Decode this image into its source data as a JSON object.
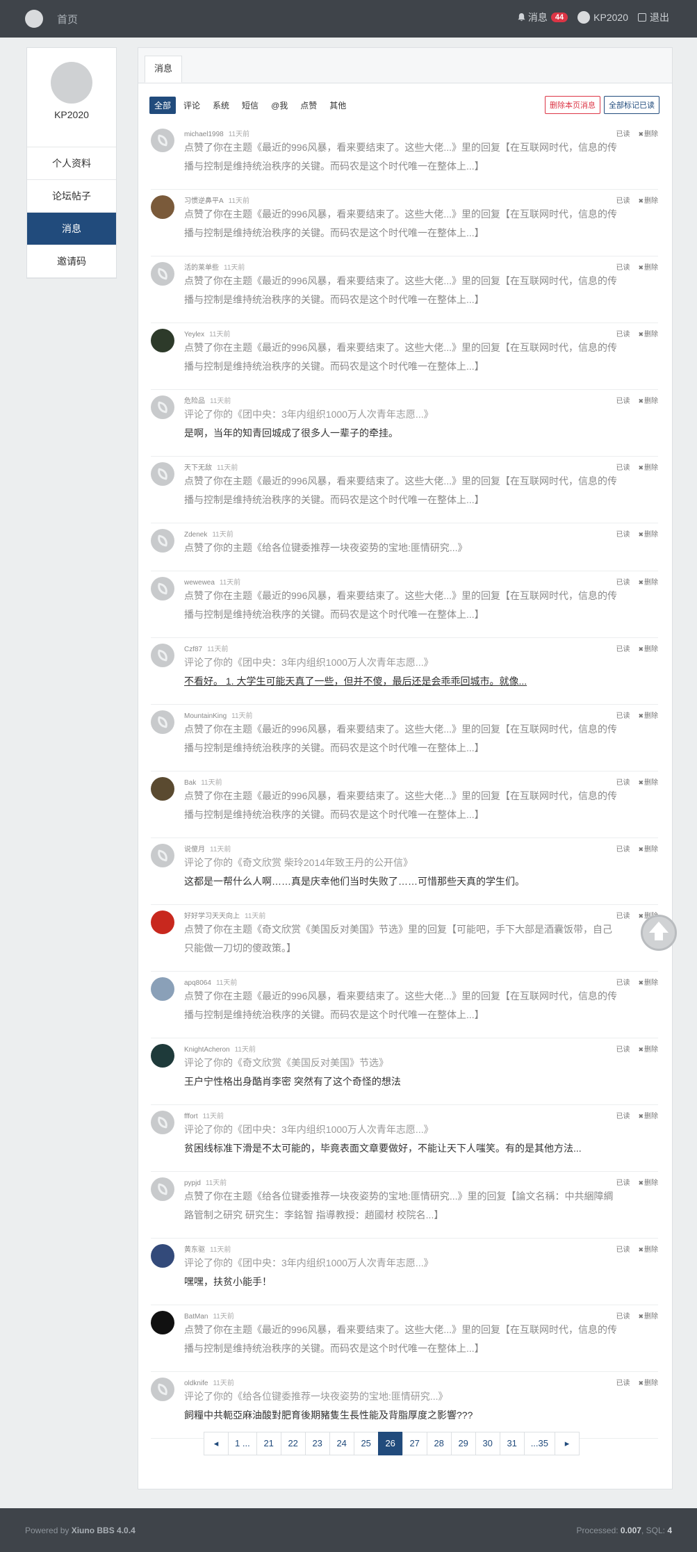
{
  "nav": {
    "home": "首页",
    "messages_label": "消息",
    "messages_count": "44",
    "user": "KP2020",
    "logout": "退出"
  },
  "sidebar": {
    "username": "KP2020",
    "items": [
      {
        "label": "个人资料"
      },
      {
        "label": "论坛帖子"
      },
      {
        "label": "消息",
        "active": true
      },
      {
        "label": "邀请码"
      }
    ]
  },
  "main": {
    "tab": "消息",
    "filters": [
      "全部",
      "评论",
      "系统",
      "短信",
      "@我",
      "点赞",
      "其他"
    ],
    "delete_page": "删除本页消息",
    "mark_all_read": "全部标记已读",
    "read_label": "已读",
    "delete_label": "删除",
    "messages": [
      {
        "user": "michael1998",
        "time": "11天前",
        "line1": "点赞了你在主题《最近的996风暴，看来要结束了。这些大佬...》里的回复【在互联网时代，信息的传",
        "line2": "播与控制是维持统治秩序的关键。而码农是这个时代唯一在整体上...】",
        "kind": "like2"
      },
      {
        "user": "习惯逆鼻平A",
        "time": "11天前",
        "line1": "点赞了你在主题《最近的996风暴，看来要结束了。这些大佬...》里的回复【在互联网时代，信息的传",
        "line2": "播与控制是维持统治秩序的关键。而码农是这个时代唯一在整体上...】",
        "kind": "like2",
        "avatar": "#7a5a3a"
      },
      {
        "user": "活的莱单些",
        "time": "11天前",
        "line1": "点赞了你在主题《最近的996风暴，看来要结束了。这些大佬...》里的回复【在互联网时代，信息的传",
        "line2": "播与控制是维持统治秩序的关键。而码农是这个时代唯一在整体上...】",
        "kind": "like2"
      },
      {
        "user": "Yeylex",
        "time": "11天前",
        "line1": "点赞了你在主题《最近的996风暴，看来要结束了。这些大佬...》里的回复【在互联网时代，信息的传",
        "line2": "播与控制是维持统治秩序的关键。而码农是这个时代唯一在整体上...】",
        "kind": "like2",
        "avatar": "#2d3a2a"
      },
      {
        "user": "危险品",
        "time": "11天前",
        "line1": "评论了你的《团中央：3年内组织1000万人次青年志愿...》",
        "line2": "是啊，当年的知青回城成了很多人一辈子的牵挂。",
        "kind": "comment"
      },
      {
        "user": "天下无敌",
        "time": "11天前",
        "line1": "点赞了你在主题《最近的996风暴，看来要结束了。这些大佬...》里的回复【在互联网时代，信息的传",
        "line2": "播与控制是维持统治秩序的关键。而码农是这个时代唯一在整体上...】",
        "kind": "like2"
      },
      {
        "user": "Zdenek",
        "time": "11天前",
        "line1": "点赞了你的主题《给各位键委推荐一块夜姿势的宝地:匪情研究...》",
        "line2": "",
        "kind": "like1"
      },
      {
        "user": "wewewea",
        "time": "11天前",
        "line1": "点赞了你在主题《最近的996风暴，看来要结束了。这些大佬...》里的回复【在互联网时代，信息的传",
        "line2": "播与控制是维持统治秩序的关键。而码农是这个时代唯一在整体上...】",
        "kind": "like2"
      },
      {
        "user": "Czf87",
        "time": "11天前",
        "line1": "评论了你的《团中央：3年内组织1000万人次青年志愿...》",
        "line2": "不看好。 1. 大学生可能天真了一些，但并不傻，最后还是会乖乖回城市。就像...",
        "kind": "comment",
        "underline": true
      },
      {
        "user": "MountainKing",
        "time": "11天前",
        "line1": "点赞了你在主题《最近的996风暴，看来要结束了。这些大佬...》里的回复【在互联网时代，信息的传",
        "line2": "播与控制是维持统治秩序的关键。而码农是这个时代唯一在整体上...】",
        "kind": "like2"
      },
      {
        "user": "Bak",
        "time": "11天前",
        "line1": "点赞了你在主题《最近的996风暴，看来要结束了。这些大佬...》里的回复【在互联网时代，信息的传",
        "line2": "播与控制是维持统治秩序的关键。而码农是这个时代唯一在整体上...】",
        "kind": "like2",
        "avatar": "#5a4a30"
      },
      {
        "user": "说傻月",
        "time": "11天前",
        "line1": "评论了你的《奇文欣赏 柴玲2014年致王丹的公开信》",
        "line2": "这都是一帮什么人啊……真是庆幸他们当时失败了……可惜那些天真的学生们。",
        "kind": "comment"
      },
      {
        "user": "好好学习天天向上",
        "time": "11天前",
        "line1": "点赞了你在主题《奇文欣赏《美国反对美国》节选》里的回复【可能吧，手下大部是酒囊饭带，自己",
        "line2": "只能做一刀切的傻政策。】",
        "kind": "like2",
        "avatar": "#c8281e"
      },
      {
        "user": "apq8064",
        "time": "11天前",
        "line1": "点赞了你在主题《最近的996风暴，看来要结束了。这些大佬...》里的回复【在互联网时代，信息的传",
        "line2": "播与控制是维持统治秩序的关键。而码农是这个时代唯一在整体上...】",
        "kind": "like2",
        "avatar": "#8aa0b8"
      },
      {
        "user": "KnightAcheron",
        "time": "11天前",
        "line1": "评论了你的《奇文欣赏《美国反对美国》节选》",
        "line2": "王户宁性格出身酷肖李密 突然有了这个奇怪的想法",
        "kind": "comment",
        "avatar": "#1e3a3a"
      },
      {
        "user": "fffort",
        "time": "11天前",
        "line1": "评论了你的《团中央：3年内组织1000万人次青年志愿...》",
        "line2": "贫困线标准下滑是不太可能的，毕竟表面文章要做好，不能让天下人嗤笑。有的是其他方法...",
        "kind": "comment"
      },
      {
        "user": "pypjd",
        "time": "11天前",
        "line1": "点赞了你在主题《给各位键委推荐一块夜姿势的宝地:匪情研究...》里的回复【論文名稱：中共綑障綢",
        "line2": "路管制之研究 研究生：李銘智 指導教授：趙國材 校院名...】",
        "kind": "like2"
      },
      {
        "user": "黄东驱",
        "time": "11天前",
        "line1": "评论了你的《团中央：3年内组织1000万人次青年志愿...》",
        "line2": "嘿嘿，扶贫小能手！",
        "kind": "comment",
        "avatar": "#334a7a"
      },
      {
        "user": "BatMan",
        "time": "11天前",
        "line1": "点赞了你在主题《最近的996风暴，看来要结束了。这些大佬...》里的回复【在互联网时代，信息的传",
        "line2": "播与控制是维持统治秩序的关键。而码农是这个时代唯一在整体上...】",
        "kind": "like2",
        "avatar": "#111111"
      },
      {
        "user": "oldknife",
        "time": "11天前",
        "line1": "评论了你的《给各位键委推荐一块夜姿势的宝地:匪情研究...》",
        "line2": "飼糧中共軛亞麻油酸對肥育後期豬隻生長性能及背脂厚度之影響???",
        "kind": "comment"
      }
    ]
  },
  "pager": [
    "◂",
    "1 ...",
    "21",
    "22",
    "23",
    "24",
    "25",
    "26",
    "27",
    "28",
    "29",
    "30",
    "31",
    "...35",
    "▸"
  ],
  "pager_active": "26",
  "footer": {
    "powered_prefix": "Powered by",
    "powered_name": "Xiuno BBS 4.0.4",
    "processed_label": "Processed:",
    "processed_value": "0.007",
    "sql_label": ", SQL:",
    "sql_value": "4"
  }
}
